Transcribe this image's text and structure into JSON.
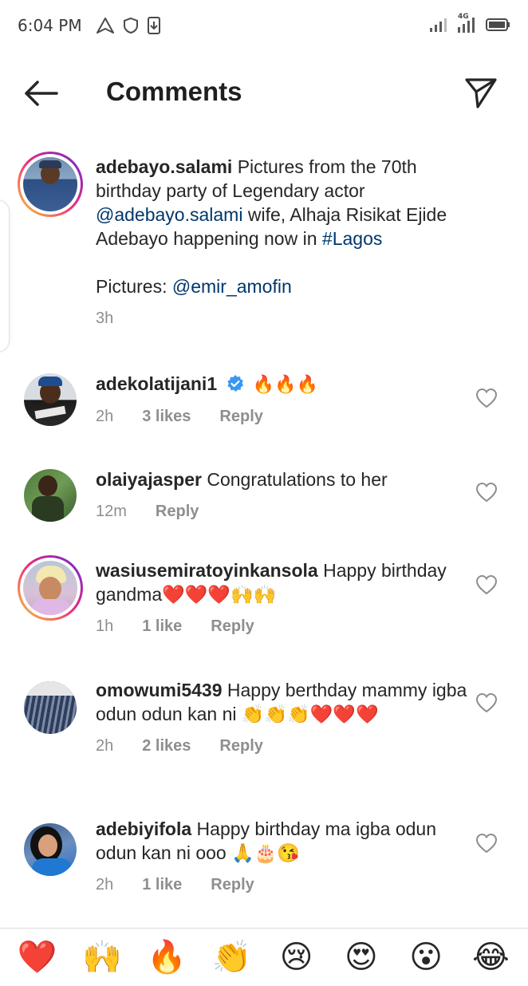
{
  "status_bar": {
    "time": "6:04 PM",
    "icons_left": [
      "navigation-icon",
      "shield-icon",
      "download-icon"
    ],
    "icons_right": [
      "signal-icon",
      "4g-signal-icon",
      "battery-icon"
    ],
    "network_label": "4G"
  },
  "header": {
    "title": "Comments",
    "back_icon": "back-arrow-icon",
    "send_icon": "send-icon"
  },
  "caption": {
    "username": "adebayo.salami",
    "text_1": " Pictures from the 70th birthday party of Legendary actor ",
    "mention_1": "@adebayo.salami",
    "text_2": " wife, Alhaja Risikat Ejide Adebayo happening now in ",
    "hashtag": "#Lagos",
    "pictures_label": "Pictures: ",
    "mention_2": "@emir_amofin",
    "time": "3h"
  },
  "comments": [
    {
      "username": "adekolatijani1",
      "verified": true,
      "text": "🔥🔥🔥",
      "time": "2h",
      "likes": "3 likes",
      "reply": "Reply"
    },
    {
      "username": "olaiyajasper",
      "text": "Congratulations to her",
      "time": "12m",
      "likes": "",
      "reply": "Reply"
    },
    {
      "username": "wasiusemiratoyinkansola",
      "text": "Happy birthday gandma❤️❤️❤️🙌🙌",
      "time": "1h",
      "likes": "1 like",
      "reply": "Reply"
    },
    {
      "username": "omowumi5439",
      "text": "Happy berthday mammy igba odun odun kan ni 👏👏👏❤️❤️❤️",
      "time": "2h",
      "likes": "2 likes",
      "reply": "Reply"
    },
    {
      "username": "adebiyifola",
      "text": "Happy birthday ma igba odun odun kan ni ooo 🙏🎂😘",
      "time": "2h",
      "likes": "1 like",
      "reply": "Reply"
    }
  ],
  "emoji_bar": [
    "❤️",
    "🙌",
    "🔥",
    "👏",
    "😢",
    "😍",
    "😮",
    "😂"
  ],
  "colors": {
    "link": "#00376b",
    "secondary_text": "#8e8e8e",
    "verified_blue": "#3897f0"
  }
}
